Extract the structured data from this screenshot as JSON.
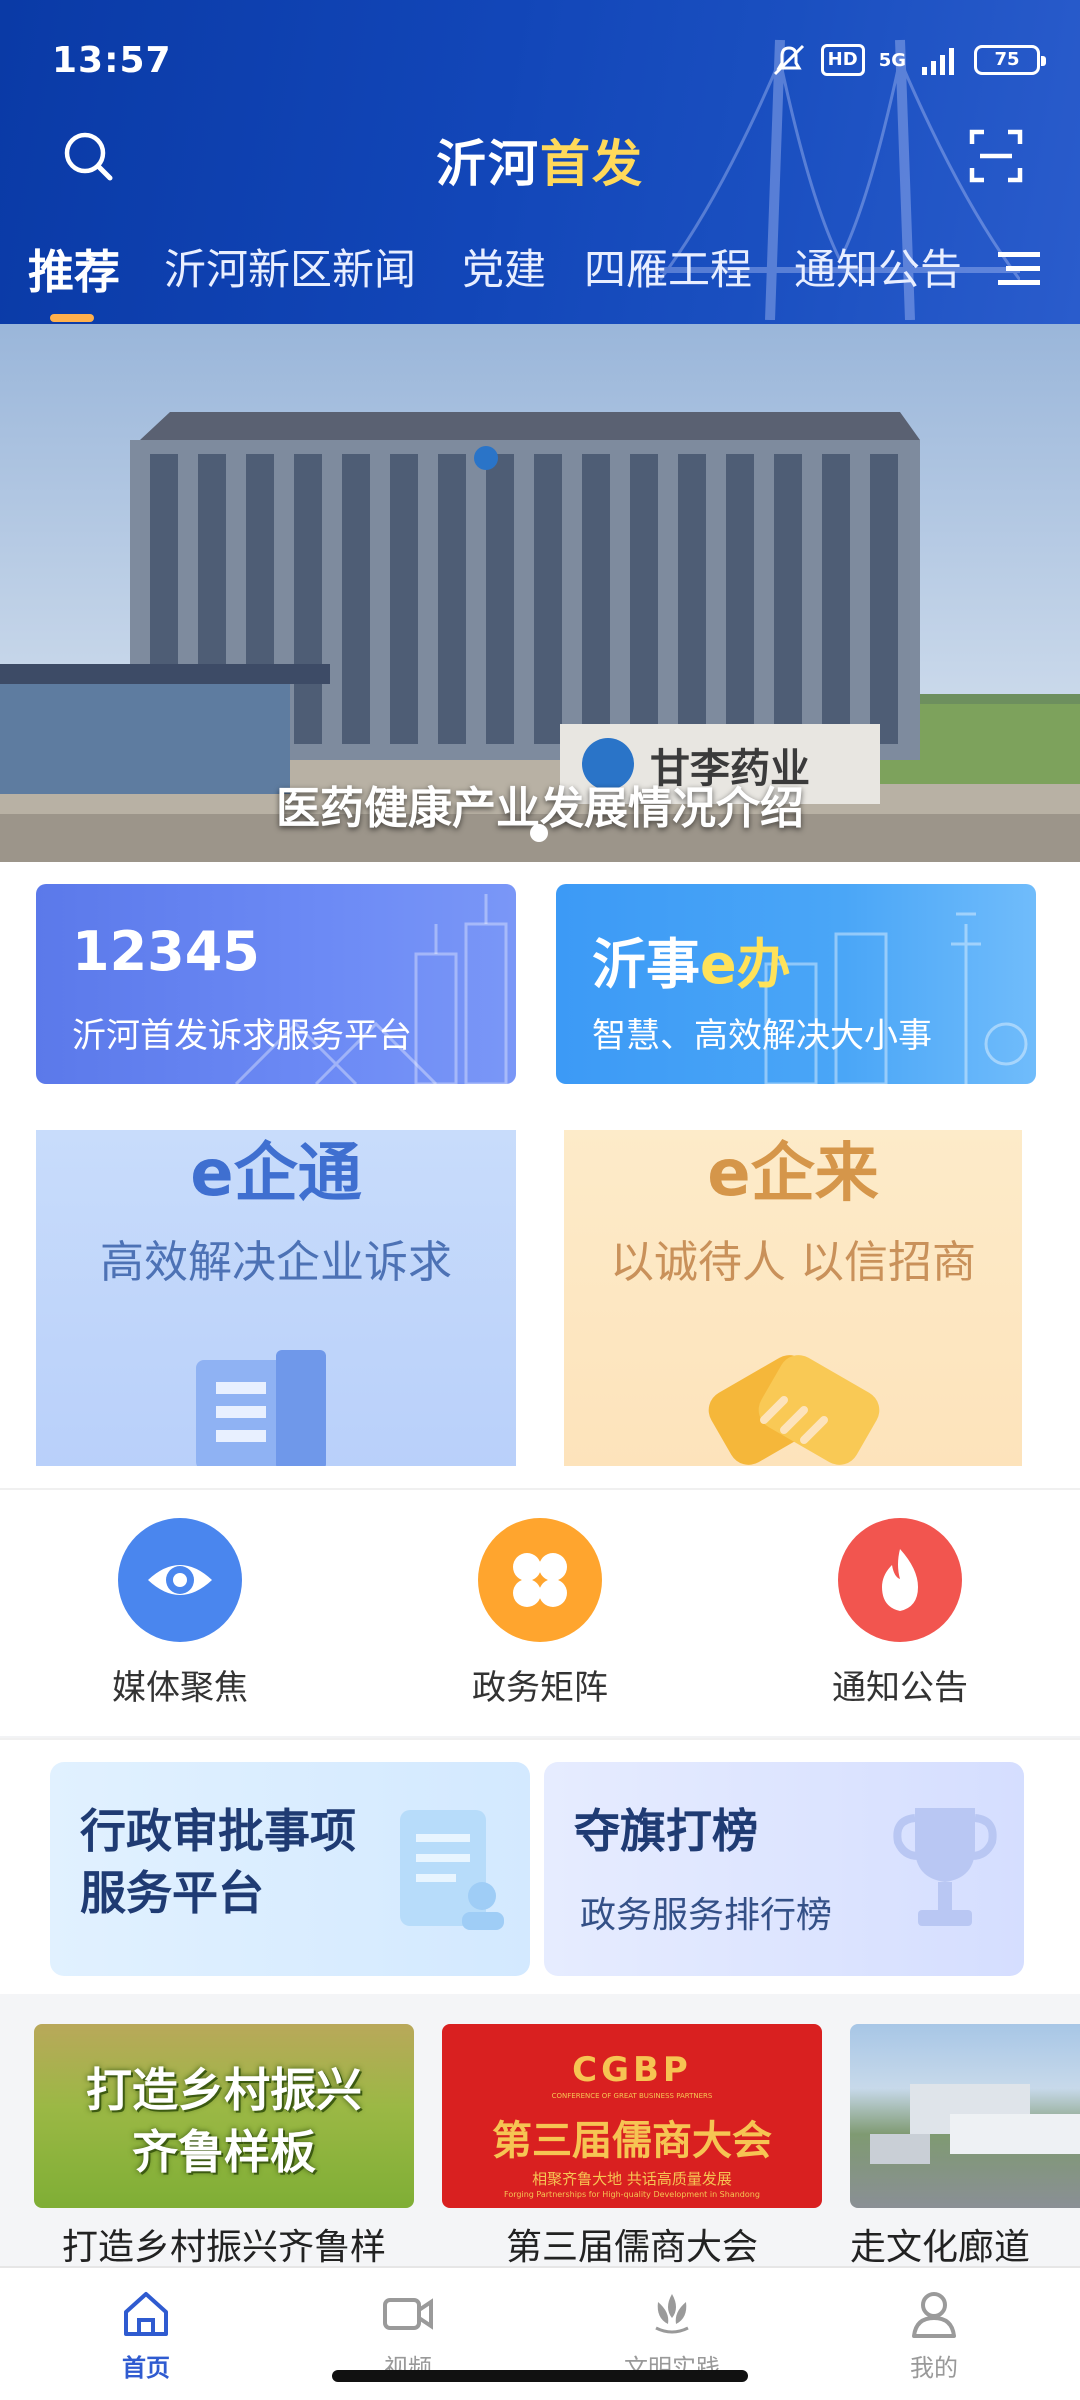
{
  "status_bar": {
    "time": "13:57",
    "hd": "HD",
    "network": "5G",
    "battery": "75",
    "icons": [
      "mute-bell-icon",
      "hd-icon",
      "signal-5g-icon",
      "battery-icon"
    ]
  },
  "header": {
    "title_main": "沂河",
    "title_accent": "首发",
    "search_icon": "search-icon",
    "scan_icon": "scan-icon",
    "menu_icon": "menu-icon",
    "colors": {
      "primary": "#1246b8",
      "accent": "#ffd95a",
      "tab_indicator": "#ffb04d"
    }
  },
  "tabs": [
    {
      "label": "推荐",
      "active": true
    },
    {
      "label": "沂河新区新闻",
      "active": false
    },
    {
      "label": "党建",
      "active": false
    },
    {
      "label": "四雁工程",
      "active": false
    },
    {
      "label": "通知公告",
      "active": false
    }
  ],
  "banner": {
    "caption": "医药健康产业发展情况介绍",
    "sign_text": "甘李药业"
  },
  "service_cards": [
    {
      "title": "12345",
      "subtitle": "沂河首发诉求服务平台"
    },
    {
      "title_a": "沂事",
      "title_b": "e办",
      "subtitle": "智慧、高效解决大小事"
    }
  ],
  "e_cards": [
    {
      "title": "e企通",
      "subtitle": "高效解决企业诉求"
    },
    {
      "title": "e企来",
      "subtitle": "以诚待人 以信招商"
    }
  ],
  "quick_links": [
    {
      "label": "媒体聚焦",
      "icon": "eye-icon",
      "color": "#4a86ee"
    },
    {
      "label": "政务矩阵",
      "icon": "clover-icon",
      "color": "#ffa52e"
    },
    {
      "label": "通知公告",
      "icon": "flame-icon",
      "color": "#f2554f"
    }
  ],
  "feature_cards": [
    {
      "title_line1": "行政审批事项",
      "title_line2": "服务平台"
    },
    {
      "title": "夺旗打榜",
      "subtitle": "政务服务排行榜"
    }
  ],
  "news": [
    {
      "image_text_1": "打造乡村振兴",
      "image_text_2": "齐鲁样板",
      "caption": "打造乡村振兴齐鲁样"
    },
    {
      "image_logo": "CGBP",
      "image_logo_sub": "CONFERENCE OF GREAT BUSINESS PARTNERS",
      "image_title": "第三届儒商大会",
      "image_slogan": "相聚齐鲁大地 共话高质量发展",
      "image_slogan_en": "Forging Partnerships for High-quality Development in Shandong",
      "caption": "第三届儒商大会"
    },
    {
      "caption": "走文化廊道"
    }
  ],
  "bottom_nav": [
    {
      "label": "首页",
      "icon": "home-icon",
      "active": true
    },
    {
      "label": "视频",
      "icon": "video-icon",
      "active": false
    },
    {
      "label": "文明实践",
      "icon": "flame-logo-icon",
      "active": false
    },
    {
      "label": "我的",
      "icon": "user-icon",
      "active": false
    }
  ]
}
